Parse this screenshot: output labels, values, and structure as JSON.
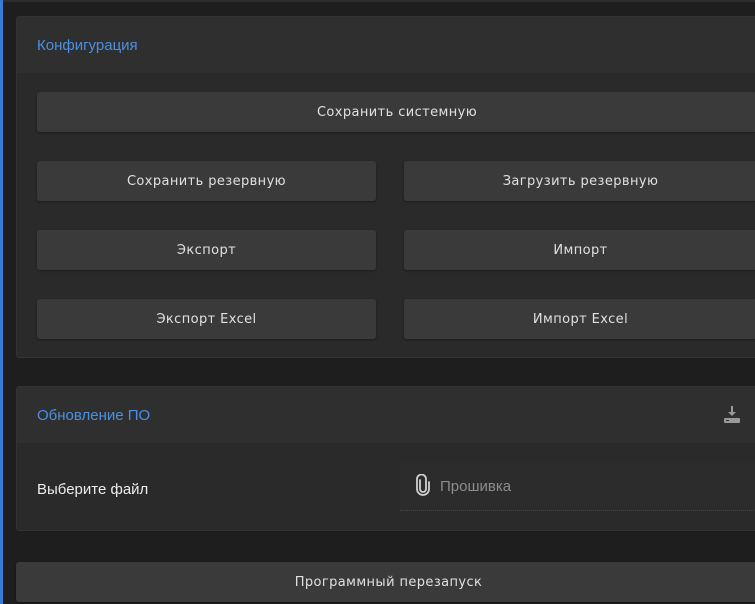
{
  "config": {
    "title": "Конфигурация",
    "save_system": "Сохранить системную",
    "save_backup": "Сохранить резервную",
    "load_backup": "Загрузить резервную",
    "export": "Экспорт",
    "import": "Импорт",
    "export_excel": "Экспорт Excel",
    "import_excel": "Импорт Excel"
  },
  "firmware": {
    "title": "Обновление ПО",
    "file_label": "Выберите файл",
    "file_placeholder": "Прошивка",
    "upload_icon": "upload-icon",
    "attach_icon": "paperclip-icon"
  },
  "restart": {
    "label": "Программный перезапуск"
  },
  "colors": {
    "accent": "#4a90e2",
    "background": "#1e1e1e",
    "card": "#2a2a2a",
    "button": "#3a3a3a"
  }
}
